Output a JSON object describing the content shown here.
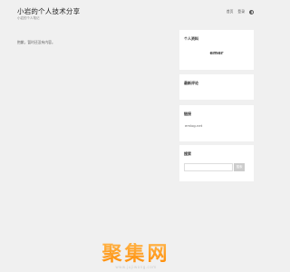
{
  "header": {
    "site_title": "小岩的个人技术分享",
    "site_desc": "小岩的个人笔记",
    "nav": {
      "home": "首页",
      "login": "登录"
    }
  },
  "main": {
    "no_content": "抱歉，暂时还没有内容。"
  },
  "sidebar": {
    "profile": {
      "title": "个人资料",
      "blogger": "emer"
    },
    "comments": {
      "title": "最新评论"
    },
    "links": {
      "title": "链接",
      "item": "emlog.net"
    },
    "search": {
      "title": "搜索",
      "placeholder": "",
      "button": "搜索"
    }
  },
  "footer": {
    "logo_text": "聚集网",
    "logo_sub": "www.jujiwang.com"
  },
  "icons": {
    "theme": "theme-toggle-icon"
  },
  "colors": {
    "background": "#f0f0f0",
    "widget_bg": "#ffffff",
    "watermark": "#ff8a00"
  }
}
